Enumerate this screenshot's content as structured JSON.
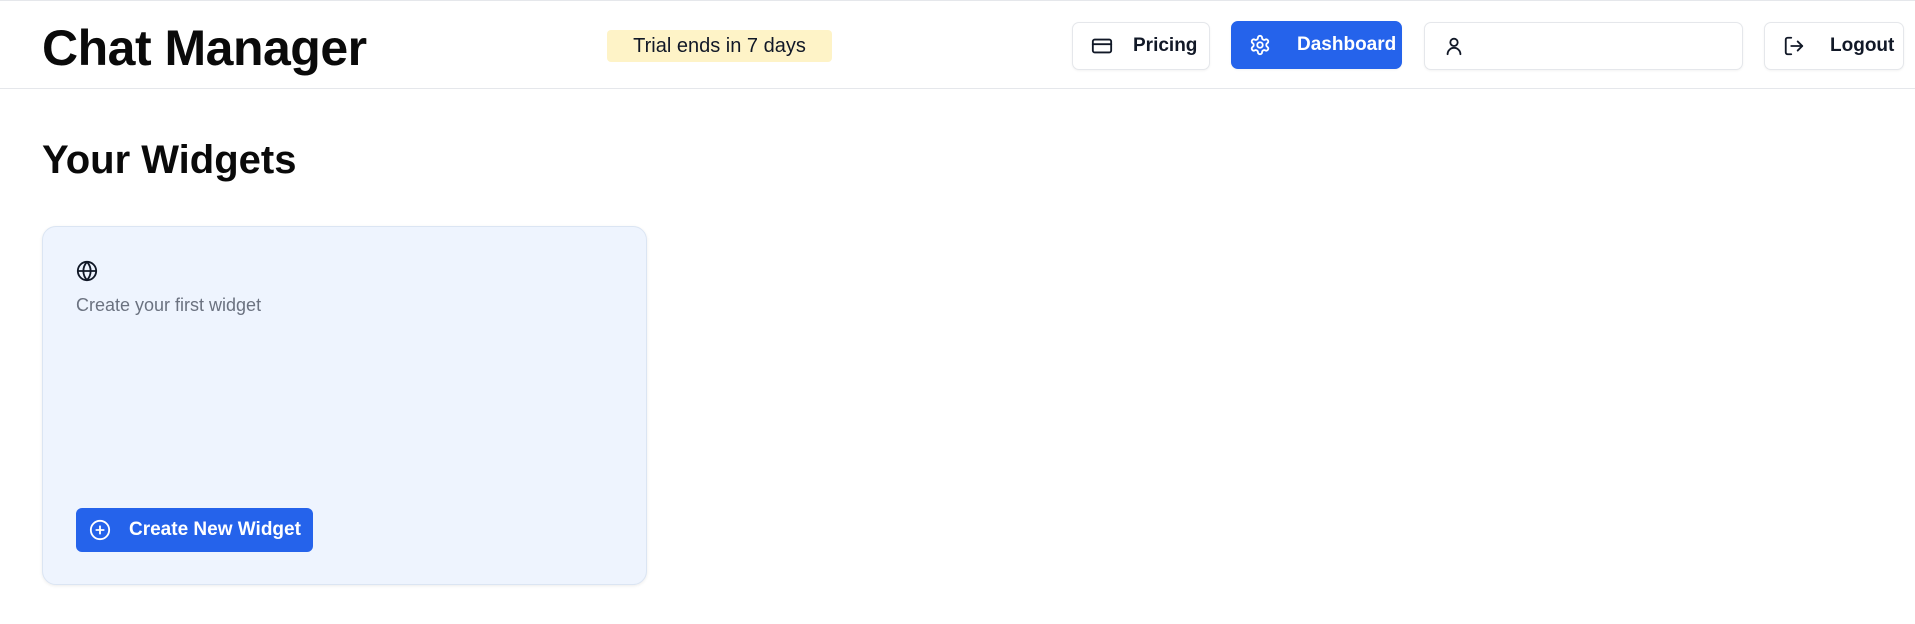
{
  "header": {
    "app_title": "Chat Manager",
    "trial_badge": "Trial ends in 7 days",
    "pricing_label": "Pricing",
    "dashboard_label": "Dashboard",
    "account_label": "",
    "logout_label": "Logout"
  },
  "main": {
    "page_title": "Your Widgets",
    "empty_card": {
      "icon": "globe-icon",
      "text": "Create your first widget",
      "button_label": "Create New Widget"
    }
  },
  "colors": {
    "accent": "#2563eb",
    "trial_badge_bg": "#fef3c7",
    "card_bg": "#eef4fe",
    "muted_text": "#6b7280"
  }
}
